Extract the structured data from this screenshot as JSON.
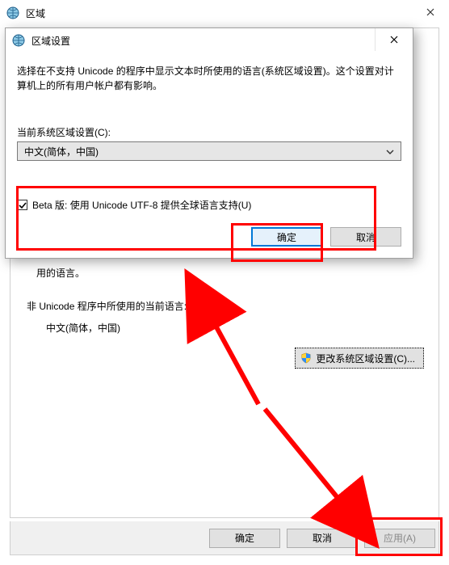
{
  "parent": {
    "title": "区域",
    "body_line": "用的语言。",
    "section_label": "非 Unicode 程序中所使用的当前语言:",
    "current_lang": "中文(简体，中国)",
    "change_button": "更改系统区域设置(C)...",
    "ok": "确定",
    "cancel": "取消",
    "apply": "应用(A)"
  },
  "modal": {
    "title": "区域设置",
    "description": "选择在不支持 Unicode 的程序中显示文本时所使用的语言(系统区域设置)。这个设置对计算机上的所有用户帐户都有影响。",
    "locale_label": "当前系统区域设置(C):",
    "locale_value": "中文(简体，中国)",
    "beta_checked": true,
    "beta_label": "Beta 版: 使用 Unicode UTF-8 提供全球语言支持(U)",
    "ok": "确定",
    "cancel": "取消"
  }
}
